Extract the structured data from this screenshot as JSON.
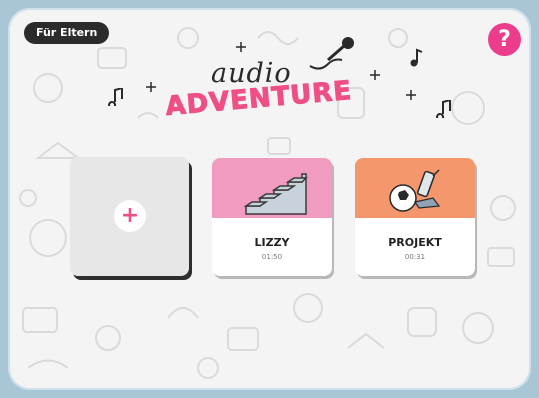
{
  "header": {
    "parents_button": "Für Eltern",
    "help_button": "?"
  },
  "logo": {
    "audio_text": "audio",
    "adventure_text": "ADVENTURE"
  },
  "cards": {
    "add_label": "+",
    "items": [
      {
        "title": "LIZZY",
        "time": "01:50",
        "color": "#f19bc1",
        "icon": "stairs-icon"
      },
      {
        "title": "PROJEKT",
        "time": "00:31",
        "color": "#f5976c",
        "icon": "soccer-glue-icon"
      }
    ]
  },
  "colors": {
    "accent": "#ef4f86",
    "help": "#ec3c8c",
    "dark": "#2b2b2b"
  }
}
